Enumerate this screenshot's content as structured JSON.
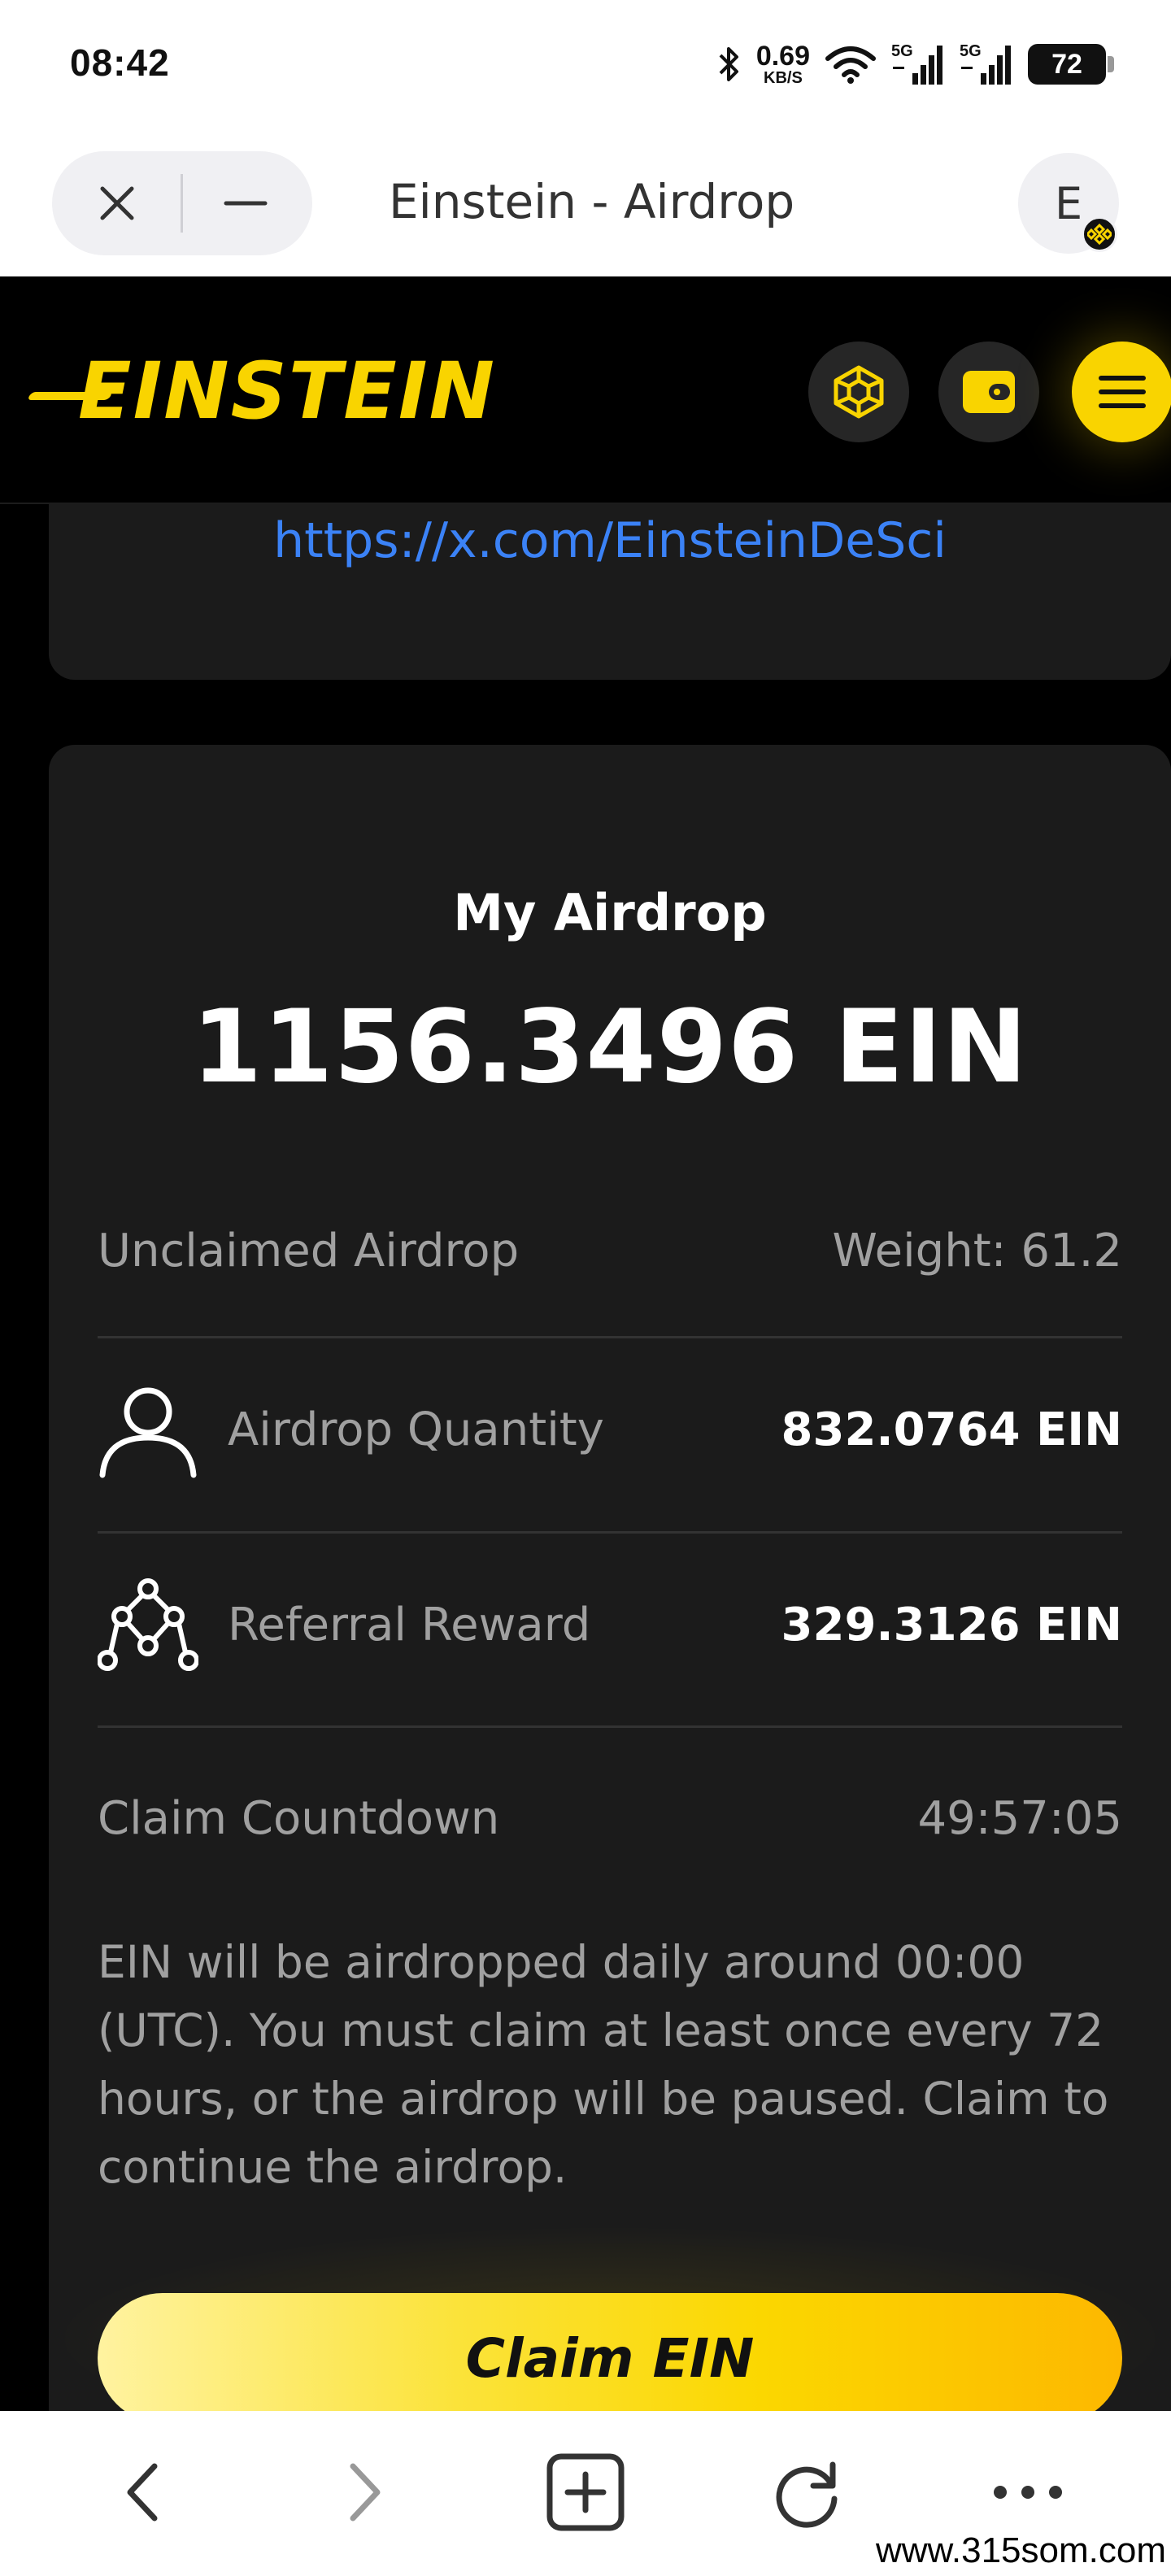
{
  "status_bar": {
    "time": "08:42",
    "net_speed_value": "0.69",
    "net_speed_unit": "KB/S",
    "signal1_label": "5G",
    "signal2_label": "5G",
    "battery": "72"
  },
  "browser": {
    "page_title": "Einstein - Airdrop",
    "profile_initial": "E"
  },
  "header": {
    "logo_text": "EINSTEIN",
    "accent_color": "#f9d400"
  },
  "links": {
    "twitter_url": "https://x.com/EinsteinDeSci"
  },
  "airdrop": {
    "title": "My Airdrop",
    "total": "1156.3496 EIN",
    "unclaimed_label": "Unclaimed Airdrop",
    "weight": "Weight: 61.2",
    "quantity_label": "Airdrop Quantity",
    "quantity_value": "832.0764 EIN",
    "referral_label": "Referral Reward",
    "referral_value": "329.3126 EIN",
    "countdown_label": "Claim Countdown",
    "countdown_value": "49:57:05",
    "note": "EIN will be airdropped daily around 00:00 (UTC). You must claim at least once every 72 hours, or the airdrop will be paused. Claim to continue the airdrop.",
    "claim_button": "Claim EIN"
  },
  "watermark": "www.315som.com",
  "icons": [
    "bluetooth-icon",
    "wifi-icon",
    "signal-icon",
    "battery-icon",
    "close-icon",
    "minimize-icon",
    "bnb-icon",
    "wallet-icon",
    "menu-icon",
    "user-icon",
    "referral-icon",
    "back-icon",
    "forward-icon",
    "new-tab-icon",
    "reload-icon",
    "more-icon"
  ]
}
